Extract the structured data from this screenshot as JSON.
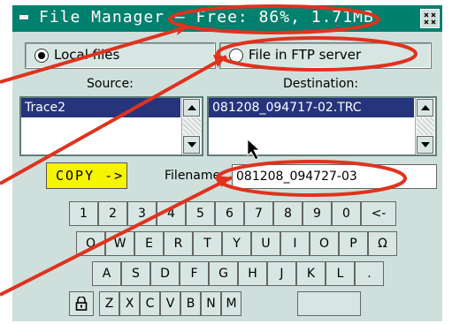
{
  "window": {
    "title": "File Manager – Free: 86%, 1.71MB"
  },
  "source_mode": {
    "local_label": "Local files",
    "ftp_label": "File in FTP server",
    "selected": "local"
  },
  "source": {
    "label": "Source:",
    "items": [
      "Trace2"
    ]
  },
  "destination": {
    "label": "Destination:",
    "items": [
      "081208_094717-02.TRC"
    ]
  },
  "actions": {
    "copy_label": "COPY ->"
  },
  "filename": {
    "label": "Filename",
    "value": "081208_094727-03"
  },
  "keyboard": {
    "row1": [
      "1",
      "2",
      "3",
      "4",
      "5",
      "6",
      "7",
      "8",
      "9",
      "0",
      "<-"
    ],
    "row2": [
      "Q",
      "W",
      "E",
      "R",
      "T",
      "Y",
      "U",
      "I",
      "O",
      "P",
      "Ω"
    ],
    "row3": [
      "A",
      "S",
      "D",
      "F",
      "G",
      "H",
      "J",
      "K",
      "L",
      "."
    ],
    "row4": [
      "Z",
      "X",
      "C",
      "V",
      "B",
      "N",
      "M"
    ]
  },
  "icons": {
    "minimize": "minimize-icon",
    "close": "close-icon",
    "shift": "lock-icon"
  },
  "colors": {
    "titlebar": "#00806e",
    "panel": "#cfe0dc",
    "selection": "#26347c",
    "copy_button": "#f6f400",
    "annotation": "#e0321e"
  }
}
